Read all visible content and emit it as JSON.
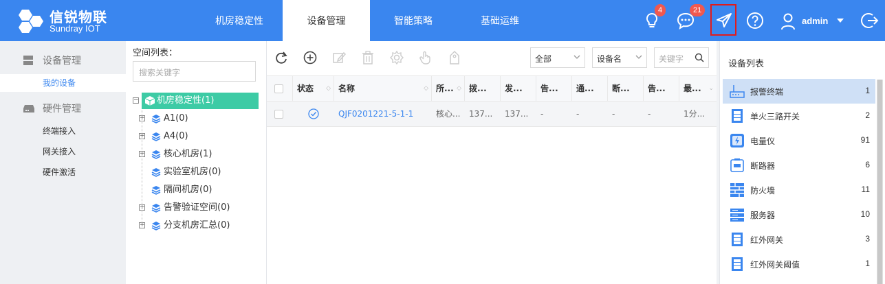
{
  "brand": {
    "name_cn": "信锐物联",
    "name_en": "Sundray IOT"
  },
  "nav": [
    {
      "label": "机房稳定性",
      "active": false
    },
    {
      "label": "设备管理",
      "active": true
    },
    {
      "label": "智能策略",
      "active": false
    },
    {
      "label": "基础运维",
      "active": false
    }
  ],
  "header": {
    "bulb_badge": "4",
    "message_badge": "21",
    "user": "admin"
  },
  "sidebar": {
    "groups": [
      {
        "label": "设备管理",
        "icon": "server-icon",
        "items": [
          {
            "label": "我的设备",
            "active": true
          }
        ]
      },
      {
        "label": "硬件管理",
        "icon": "drive-icon",
        "items": [
          {
            "label": "终端接入"
          },
          {
            "label": "网关接入"
          },
          {
            "label": "硬件激活"
          }
        ]
      }
    ]
  },
  "tree": {
    "title": "空间列表：",
    "search_placeholder": "搜索关键字",
    "root": "机房稳定性(1)",
    "nodes": [
      {
        "label": "A1(0)",
        "expandable": true
      },
      {
        "label": "A4(0)",
        "expandable": true
      },
      {
        "label": "核心机房(1)",
        "expandable": true
      },
      {
        "label": "实验室机房(0)",
        "expandable": false
      },
      {
        "label": "隔间机房(0)",
        "expandable": false
      },
      {
        "label": "告警验证空间(0)",
        "expandable": true
      },
      {
        "label": "分支机房汇总(0)",
        "expandable": true
      }
    ]
  },
  "toolbar": {
    "filter_all": "全部",
    "filter_field": "设备名",
    "search_placeholder": "关键字"
  },
  "table": {
    "columns": [
      "状态",
      "名称",
      "所...",
      "拨...",
      "发...",
      "告...",
      "通...",
      "断...",
      "告...",
      "最..."
    ],
    "rows": [
      {
        "status": "ok",
        "name": "QJF0201221-5-1-1",
        "c3": "核心...",
        "c4": "137...",
        "c5": "137...",
        "c6": "-",
        "c7": "-",
        "c8": "-",
        "c9": "-",
        "c10": "1分..."
      }
    ]
  },
  "device_list": {
    "title": "设备列表",
    "items": [
      {
        "name": "报警终端",
        "count": "1",
        "icon": "alarm-terminal-icon",
        "active": true
      },
      {
        "name": "单火三路开关",
        "count": "2",
        "icon": "switch-icon"
      },
      {
        "name": "电量仪",
        "count": "91",
        "icon": "power-meter-icon"
      },
      {
        "name": "断路器",
        "count": "6",
        "icon": "breaker-icon"
      },
      {
        "name": "防火墙",
        "count": "11",
        "icon": "firewall-icon"
      },
      {
        "name": "服务器",
        "count": "10",
        "icon": "server-rack-icon"
      },
      {
        "name": "红外网关",
        "count": "3",
        "icon": "ir-gateway-icon"
      },
      {
        "name": "红外网关阈值",
        "count": "1",
        "icon": "ir-threshold-icon"
      }
    ]
  },
  "colors": {
    "primary": "#3a86ef",
    "tree_active": "#3dcba5",
    "badge": "#f0584f"
  }
}
